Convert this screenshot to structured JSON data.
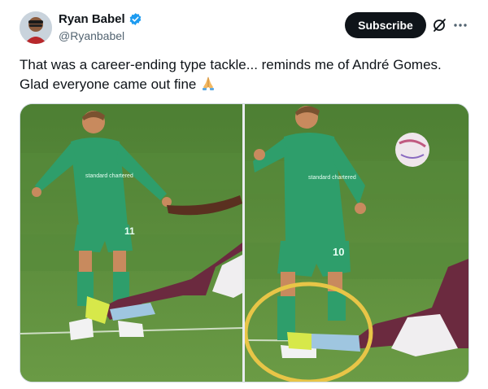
{
  "author": {
    "display_name": "Ryan Babel",
    "handle": "@Ryanbabel",
    "verified": true
  },
  "actions": {
    "subscribe_label": "Subscribe",
    "grok_icon": "grok-icon",
    "more_icon": "more-options-icon"
  },
  "tweet": {
    "text_line1": "That was a career-ending type tackle... reminds me of André Gomes.",
    "text_line2": "Glad everyone came out fine",
    "emoji": "folded-hands-emoji"
  },
  "media": {
    "left_panel_kit_text": "standard chartered",
    "left_panel_number": "11",
    "right_panel_kit_text": "standard chartered",
    "right_panel_number": "10",
    "highlight_color": "#e8c547"
  },
  "colors": {
    "verified": "#1d9bf0",
    "button_bg": "#0f1419",
    "pitch": "#5b8a3d",
    "kit_green": "#2e9e6b",
    "opponent_claret": "#6b2a3f"
  }
}
